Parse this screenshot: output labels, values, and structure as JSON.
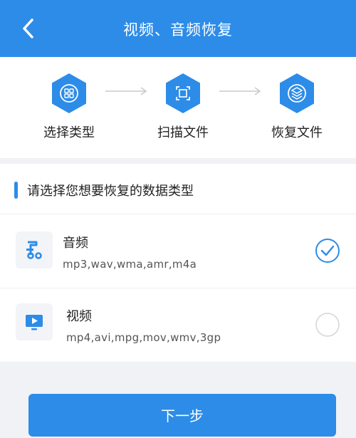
{
  "header": {
    "title": "视频、音频恢复",
    "back_icon": "back-arrow-icon"
  },
  "steps": [
    {
      "label": "选择类型",
      "icon": "category-icon"
    },
    {
      "label": "扫描文件",
      "icon": "scan-icon"
    },
    {
      "label": "恢复文件",
      "icon": "layers-icon"
    }
  ],
  "section": {
    "title": "请选择您想要恢复的数据类型"
  },
  "file_types": [
    {
      "name": "音频",
      "formats": "mp3,wav,wma,amr,m4a",
      "selected": true,
      "icon": "audio-icon"
    },
    {
      "name": "视频",
      "formats": "mp4,avi,mpg,mov,wmv,3gp",
      "selected": false,
      "icon": "video-icon"
    }
  ],
  "next_button": {
    "label": "下一步"
  },
  "colors": {
    "primary": "#2d8ce8",
    "background": "#f1f2f5"
  }
}
